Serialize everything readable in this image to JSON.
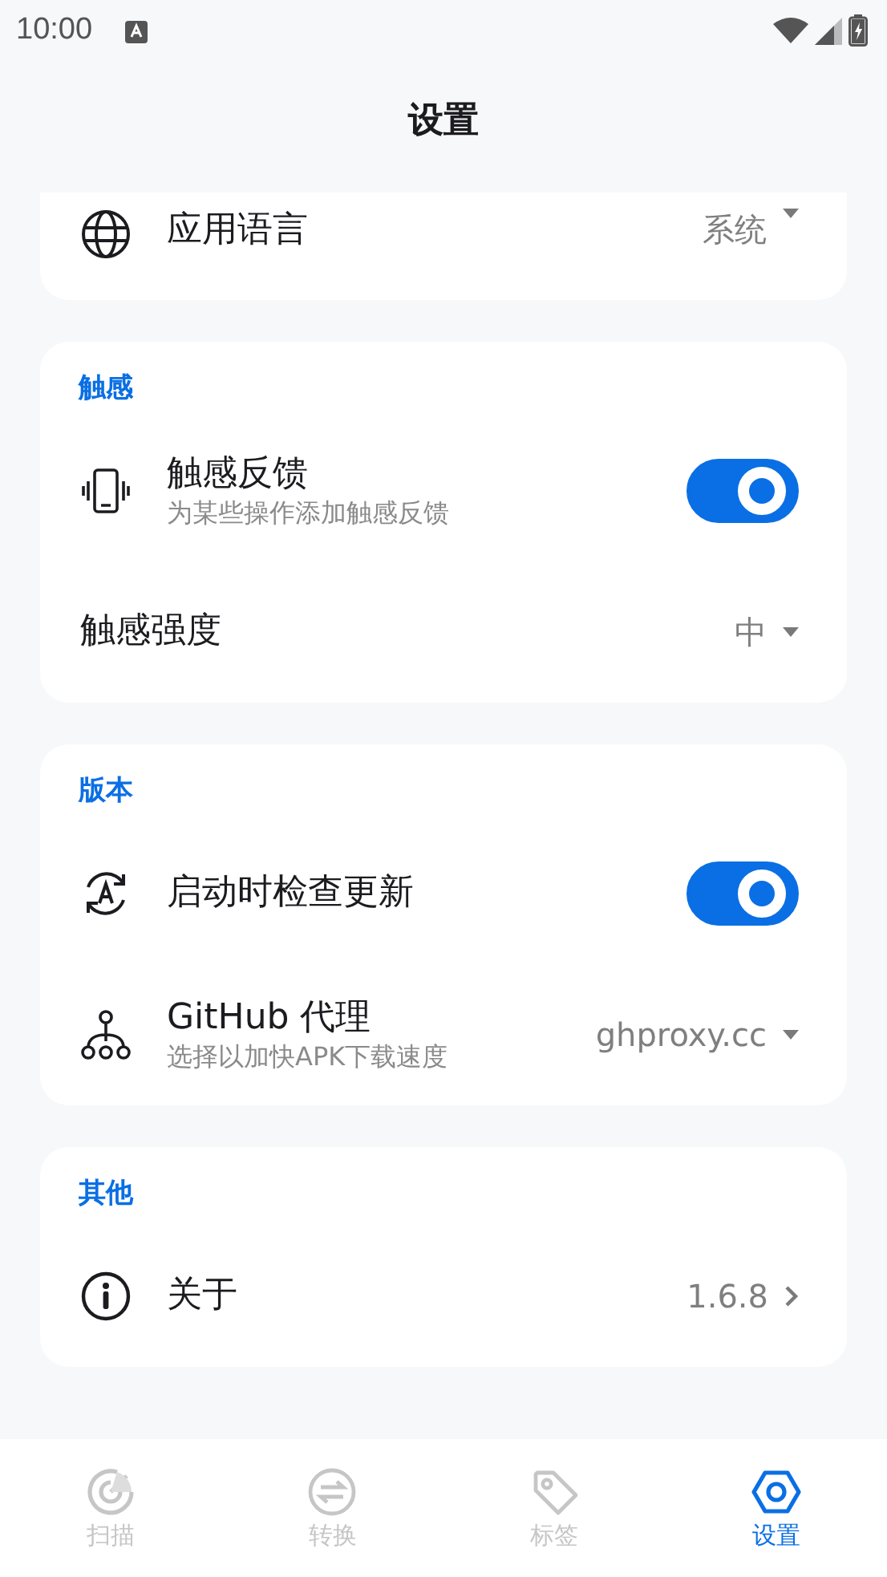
{
  "status_bar": {
    "time": "10:00"
  },
  "title": "设置",
  "sections": [
    {
      "items": [
        {
          "kind": "dropdown",
          "label": "应用语言",
          "value": "系统"
        }
      ]
    },
    {
      "header": "触感",
      "items": [
        {
          "kind": "toggle",
          "label": "触感反馈",
          "subtitle": "为某些操作添加触感反馈",
          "on": true
        },
        {
          "kind": "dropdown",
          "label": "触感强度",
          "value": "中"
        }
      ]
    },
    {
      "header": "版本",
      "items": [
        {
          "kind": "toggle",
          "label": "启动时检查更新",
          "on": true
        },
        {
          "kind": "dropdown",
          "label": "GitHub 代理",
          "subtitle": "选择以加快APK下载速度",
          "value": "ghproxy.cc"
        }
      ]
    },
    {
      "header": "其他",
      "items": [
        {
          "kind": "link",
          "label": "关于",
          "value": "1.6.8"
        }
      ]
    }
  ],
  "nav": [
    {
      "label": "扫描",
      "selected": false
    },
    {
      "label": "转换",
      "selected": false
    },
    {
      "label": "标签",
      "selected": false
    },
    {
      "label": "设置",
      "selected": true
    }
  ]
}
